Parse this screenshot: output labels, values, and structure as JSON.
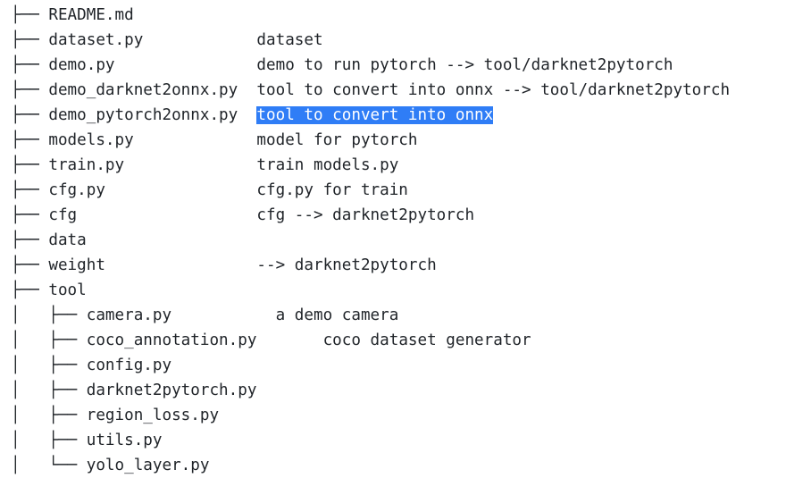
{
  "tree": {
    "rows": [
      {
        "prefix": "├── ",
        "name": "README.md",
        "gap": "",
        "desc": "",
        "selected": false
      },
      {
        "prefix": "├── ",
        "name": "dataset.py",
        "gap": "            ",
        "desc": "dataset",
        "selected": false
      },
      {
        "prefix": "├── ",
        "name": "demo.py",
        "gap": "               ",
        "desc": "demo to run pytorch --> tool/darknet2pytorch",
        "selected": false
      },
      {
        "prefix": "├── ",
        "name": "demo_darknet2onnx.py",
        "gap": "  ",
        "desc": "tool to convert into onnx --> tool/darknet2pytorch",
        "selected": false
      },
      {
        "prefix": "├── ",
        "name": "demo_pytorch2onnx.py",
        "gap": "  ",
        "desc": "tool to convert into onnx",
        "selected": true
      },
      {
        "prefix": "├── ",
        "name": "models.py",
        "gap": "             ",
        "desc": "model for pytorch",
        "selected": false
      },
      {
        "prefix": "├── ",
        "name": "train.py",
        "gap": "              ",
        "desc": "train models.py",
        "selected": false
      },
      {
        "prefix": "├── ",
        "name": "cfg.py",
        "gap": "                ",
        "desc": "cfg.py for train",
        "selected": false
      },
      {
        "prefix": "├── ",
        "name": "cfg",
        "gap": "                   ",
        "desc": "cfg --> darknet2pytorch",
        "selected": false
      },
      {
        "prefix": "├── ",
        "name": "data",
        "gap": "",
        "desc": "",
        "selected": false
      },
      {
        "prefix": "├── ",
        "name": "weight",
        "gap": "                ",
        "desc": "--> darknet2pytorch",
        "selected": false
      },
      {
        "prefix": "├── ",
        "name": "tool",
        "gap": "",
        "desc": "",
        "selected": false
      },
      {
        "prefix": "│   ├── ",
        "name": "camera.py",
        "gap": "           ",
        "desc": "a demo camera",
        "selected": false
      },
      {
        "prefix": "│   ├── ",
        "name": "coco_annotation.py",
        "gap": "       ",
        "desc": "coco dataset generator",
        "selected": false
      },
      {
        "prefix": "│   ├── ",
        "name": "config.py",
        "gap": "",
        "desc": "",
        "selected": false
      },
      {
        "prefix": "│   ├── ",
        "name": "darknet2pytorch.py",
        "gap": "",
        "desc": "",
        "selected": false
      },
      {
        "prefix": "│   ├── ",
        "name": "region_loss.py",
        "gap": "",
        "desc": "",
        "selected": false
      },
      {
        "prefix": "│   ├── ",
        "name": "utils.py",
        "gap": "",
        "desc": "",
        "selected": false
      },
      {
        "prefix": "│   └── ",
        "name": "yolo_layer.py",
        "gap": "",
        "desc": "",
        "selected": false
      }
    ]
  }
}
